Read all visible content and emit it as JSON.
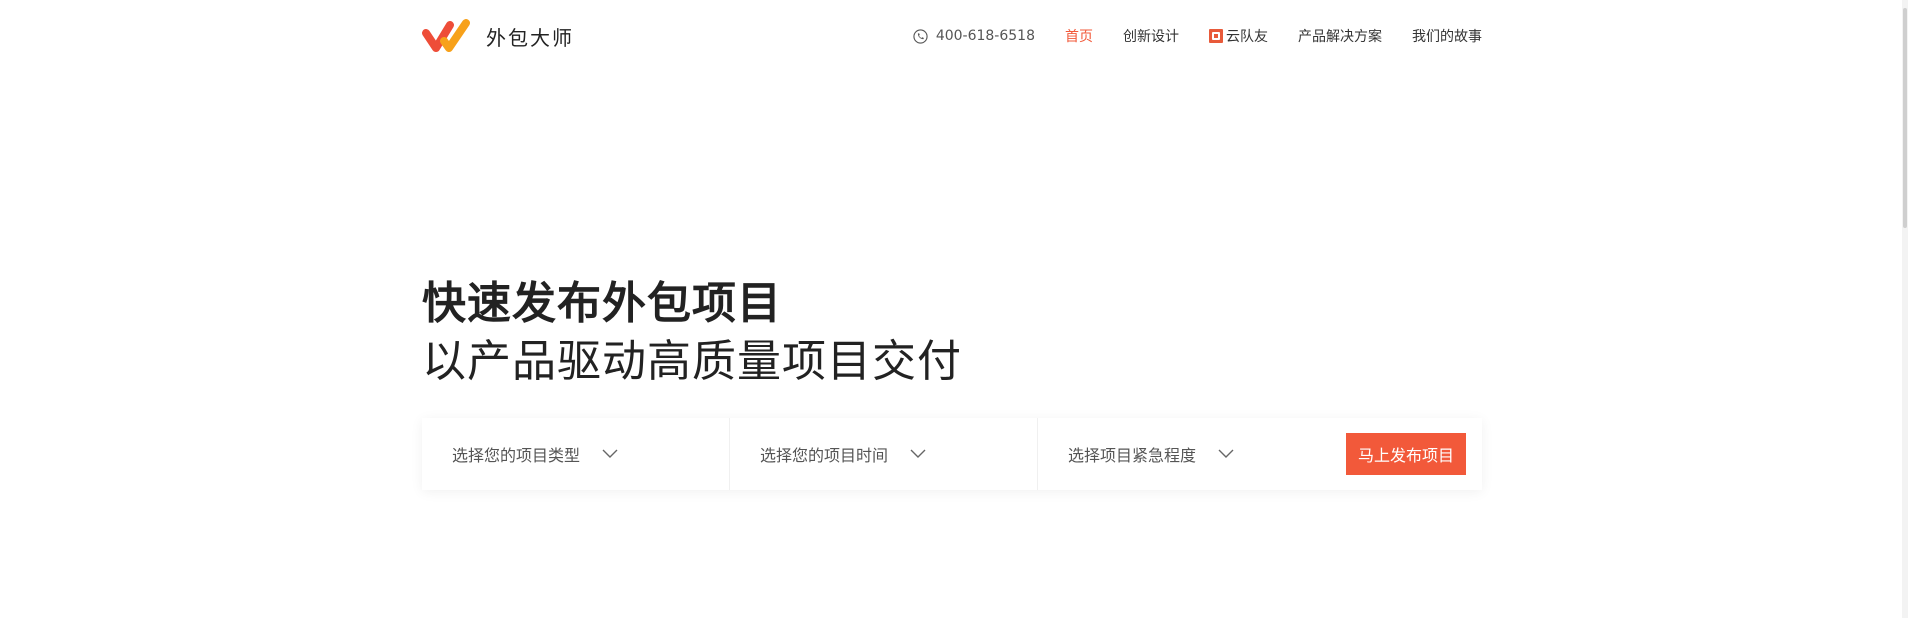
{
  "header": {
    "brand_name": "外包大师",
    "logo_icon": "brand-logo-icon",
    "nav": {
      "phone": "400-618-6518",
      "phone_icon": "phone-icon",
      "items": [
        {
          "label": "首页",
          "active": true
        },
        {
          "label": "创新设计",
          "active": false
        },
        {
          "label": "云队友",
          "active": false,
          "icon": "yun-badge-icon"
        },
        {
          "label": "产品解决方案",
          "active": false
        },
        {
          "label": "我们的故事",
          "active": false
        }
      ]
    }
  },
  "hero": {
    "title": "快速发布外包项目",
    "subtitle": "以产品驱动高质量项目交付"
  },
  "form": {
    "selects": [
      {
        "placeholder": "选择您的项目类型"
      },
      {
        "placeholder": "选择您的项目时间"
      },
      {
        "placeholder": "选择项目紧急程度"
      }
    ],
    "submit_label": "马上发布项目"
  },
  "colors": {
    "accent": "#f2593a",
    "text": "#222222",
    "logo_orange": "#f7a11a",
    "logo_red": "#ee4d38"
  }
}
